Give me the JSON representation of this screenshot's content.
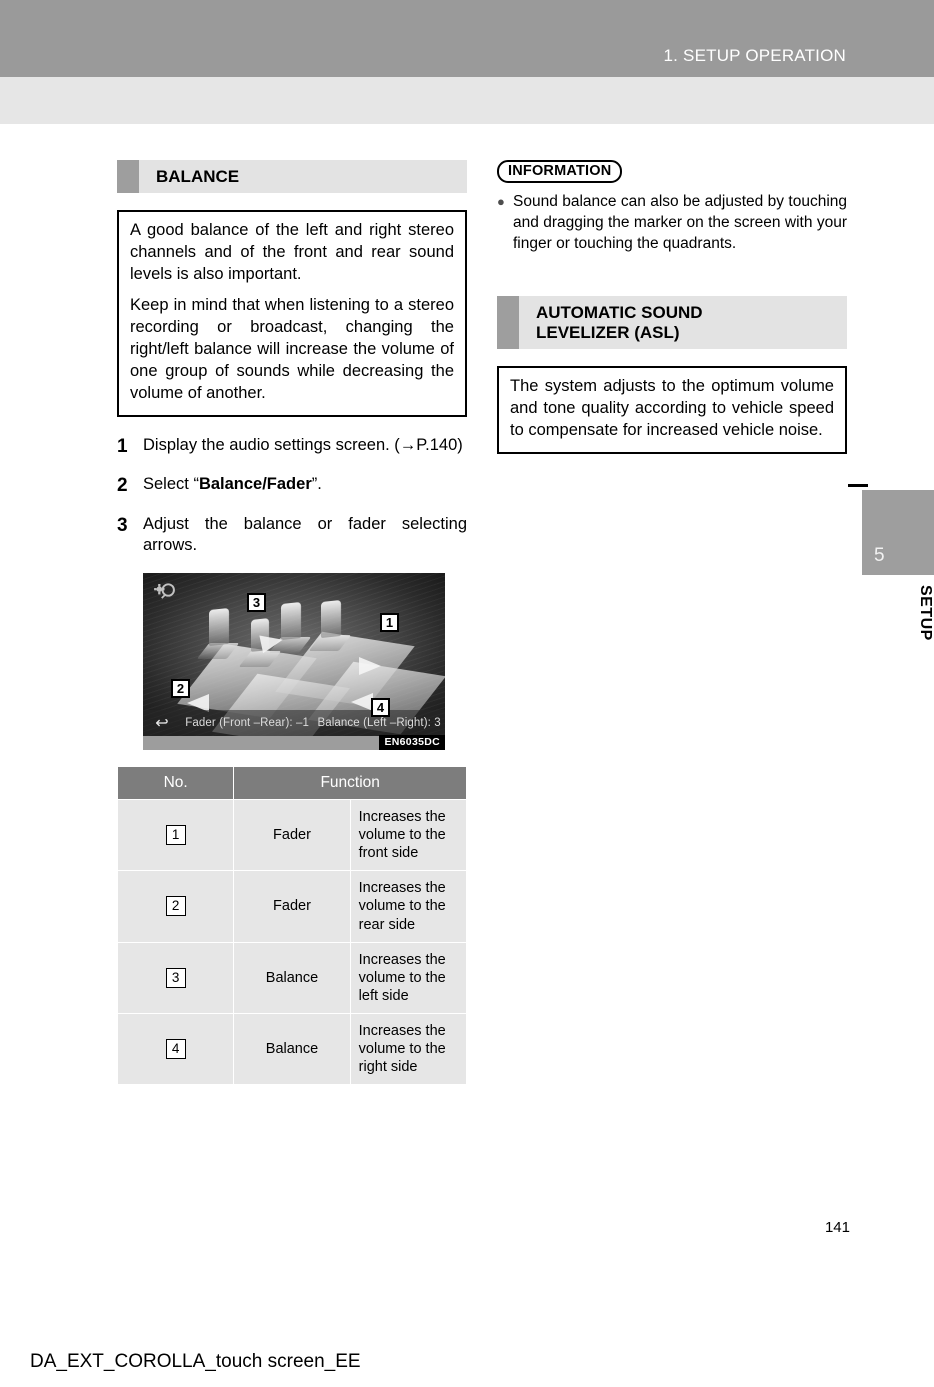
{
  "header": {
    "title": "1. SETUP OPERATION"
  },
  "side_tab": {
    "number": "5",
    "label": "SETUP"
  },
  "left_column": {
    "section": {
      "title": "BALANCE"
    },
    "intro_box": {
      "paragraphs": [
        "A good balance of the left and right stereo channels and of the front and rear sound levels is also important.",
        "Keep in mind that when listening to a stereo recording or broadcast, changing the right/left balance will increase the volume of one group of sounds while decreasing the volume of another."
      ]
    },
    "steps": [
      {
        "num": "1",
        "text_before": "Display the audio settings screen. (→P.140)",
        "bold": "",
        "text_after": ""
      },
      {
        "num": "2",
        "text_before": "Select “",
        "bold": "Balance/Fader",
        "text_after": "”."
      },
      {
        "num": "3",
        "text_before": "Adjust the balance or fader selecting arrows.",
        "bold": "",
        "text_after": ""
      }
    ],
    "screenshot": {
      "gear_icon": "settings-gear-icon",
      "back_icon": "↩",
      "fader_readout": "Fader (Front –Rear): –1",
      "balance_readout": "Balance (Left –Right): 3",
      "image_code": "EN6035DC",
      "callouts": [
        "1",
        "2",
        "3",
        "4"
      ]
    },
    "table": {
      "headers": [
        "No.",
        "Function"
      ],
      "rows": [
        {
          "no": "1",
          "name": "Fader",
          "desc": "Increases the volume to the front side"
        },
        {
          "no": "2",
          "name": "Fader",
          "desc": "Increases the volume to the rear side"
        },
        {
          "no": "3",
          "name": "Balance",
          "desc": "Increases the volume to the left side"
        },
        {
          "no": "4",
          "name": "Balance",
          "desc": "Increases the volume to the right side"
        }
      ]
    }
  },
  "right_column": {
    "information": {
      "label": "INFORMATION",
      "items": [
        "Sound balance can also be adjusted by touching and dragging the marker on the screen with your finger or touching the quadrants."
      ]
    },
    "asl_section": {
      "title": "AUTOMATIC SOUND\nLEVELIZER (ASL)",
      "body": "The system adjusts to the optimum volume and tone quality according to vehicle speed to compensate for increased vehicle noise."
    }
  },
  "footer": {
    "page_number": "141",
    "document_id": "DA_EXT_COROLLA_touch screen_EE"
  },
  "colors": {
    "header_gray": "#9a9a9a",
    "subheader_gray": "#e6e6e6",
    "section_band": "#e3e3e3",
    "section_mark": "#9e9e9e",
    "table_header": "#7d7d7d",
    "table_cell": "#e6e6e6"
  }
}
